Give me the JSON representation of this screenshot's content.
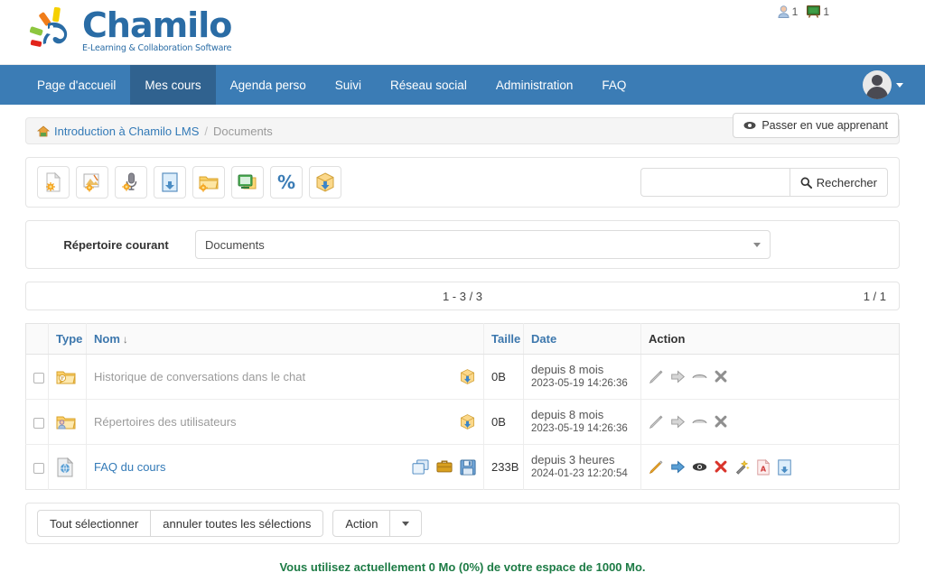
{
  "brand": {
    "name": "Chamilo",
    "tagline": "E-Learning & Collaboration Software",
    "logo_color": "#2a6ca5"
  },
  "header": {
    "counters": [
      {
        "icon": "user-icon",
        "value": "1"
      },
      {
        "icon": "blackboard-icon",
        "value": "1"
      }
    ]
  },
  "navbar": {
    "background": "#3b7cb5",
    "active_background": "#30628f",
    "items": [
      {
        "label": "Page d'accueil",
        "active": false
      },
      {
        "label": "Mes cours",
        "active": true
      },
      {
        "label": "Agenda perso",
        "active": false
      },
      {
        "label": "Suivi",
        "active": false
      },
      {
        "label": "Réseau social",
        "active": false
      },
      {
        "label": "Administration",
        "active": false
      },
      {
        "label": "FAQ",
        "active": false
      }
    ]
  },
  "breadcrumb": {
    "home_icon": "home-icon",
    "course": "Introduction à Chamilo LMS",
    "separator": "/",
    "current": "Documents",
    "learner_view_button": "Passer en vue apprenant",
    "learner_view_icon": "eye-icon"
  },
  "toolbar": {
    "buttons": [
      {
        "name": "create-document-icon",
        "title": "Créer un document"
      },
      {
        "name": "create-drawing-icon",
        "title": "Créer un dessin"
      },
      {
        "name": "record-audio-icon",
        "title": "Enregistrer un audio"
      },
      {
        "name": "upload-file-icon",
        "title": "Envoyer un fichier"
      },
      {
        "name": "create-folder-icon",
        "title": "Créer un répertoire"
      },
      {
        "name": "create-video-icon",
        "title": "Webconférence / vidéo"
      },
      {
        "name": "certificate-percent-icon",
        "title": "Modèles"
      },
      {
        "name": "download-package-icon",
        "title": "Télécharger le paquet"
      }
    ],
    "search_value": "",
    "search_placeholder": "",
    "search_button": "Rechercher",
    "search_icon": "search-icon"
  },
  "directory": {
    "label": "Répertoire courant",
    "selected": "Documents"
  },
  "pagination": {
    "range": "1 - 3 / 3",
    "pages": "1 / 1"
  },
  "table": {
    "headers": {
      "checkbox": "",
      "type": "Type",
      "name": "Nom",
      "name_sort_arrow": "↓",
      "size": "Taille",
      "date": "Date",
      "action": "Action"
    },
    "rows": [
      {
        "checked": false,
        "type_icon": "folder-chat-icon",
        "name": "Historique de conversations dans le chat",
        "name_is_link": false,
        "name_icons": [
          "download-package-icon"
        ],
        "size": "0B",
        "date_relative": "depuis 8 mois",
        "date_absolute": "2023-05-19 14:26:36",
        "actions": [
          "edit-pencil-icon",
          "move-arrow-icon",
          "visibility-icon",
          "delete-x-icon"
        ],
        "actions_disabled": true
      },
      {
        "checked": false,
        "type_icon": "folder-users-icon",
        "name": "Répertoires des utilisateurs",
        "name_is_link": false,
        "name_icons": [
          "download-package-icon"
        ],
        "size": "0B",
        "date_relative": "depuis 8 mois",
        "date_absolute": "2023-05-19 14:26:36",
        "actions": [
          "edit-pencil-icon",
          "move-arrow-icon",
          "visibility-icon",
          "delete-x-icon"
        ],
        "actions_disabled": true
      },
      {
        "checked": false,
        "type_icon": "html-file-icon",
        "name": "FAQ du cours",
        "name_is_link": true,
        "name_icons": [
          "open-window-icon",
          "briefcase-icon",
          "save-disk-icon"
        ],
        "size": "233B",
        "date_relative": "depuis 3 heures",
        "date_absolute": "2024-01-23 12:20:54",
        "actions": [
          "edit-pencil-icon",
          "move-arrow-icon",
          "visibility-eye-icon",
          "delete-x-icon",
          "magic-wand-icon",
          "pdf-export-icon",
          "upload-replace-icon"
        ],
        "actions_disabled": false
      }
    ]
  },
  "bottom_actions": {
    "select_all": "Tout sélectionner",
    "unselect_all": "annuler toutes les sélections",
    "action_button": "Action",
    "dropdown_icon": "caret-down-icon"
  },
  "quota": {
    "message": "Vous utilisez actuellement 0 Mo (0%) de votre espace de 1000 Mo.",
    "color": "#1d7b45"
  }
}
